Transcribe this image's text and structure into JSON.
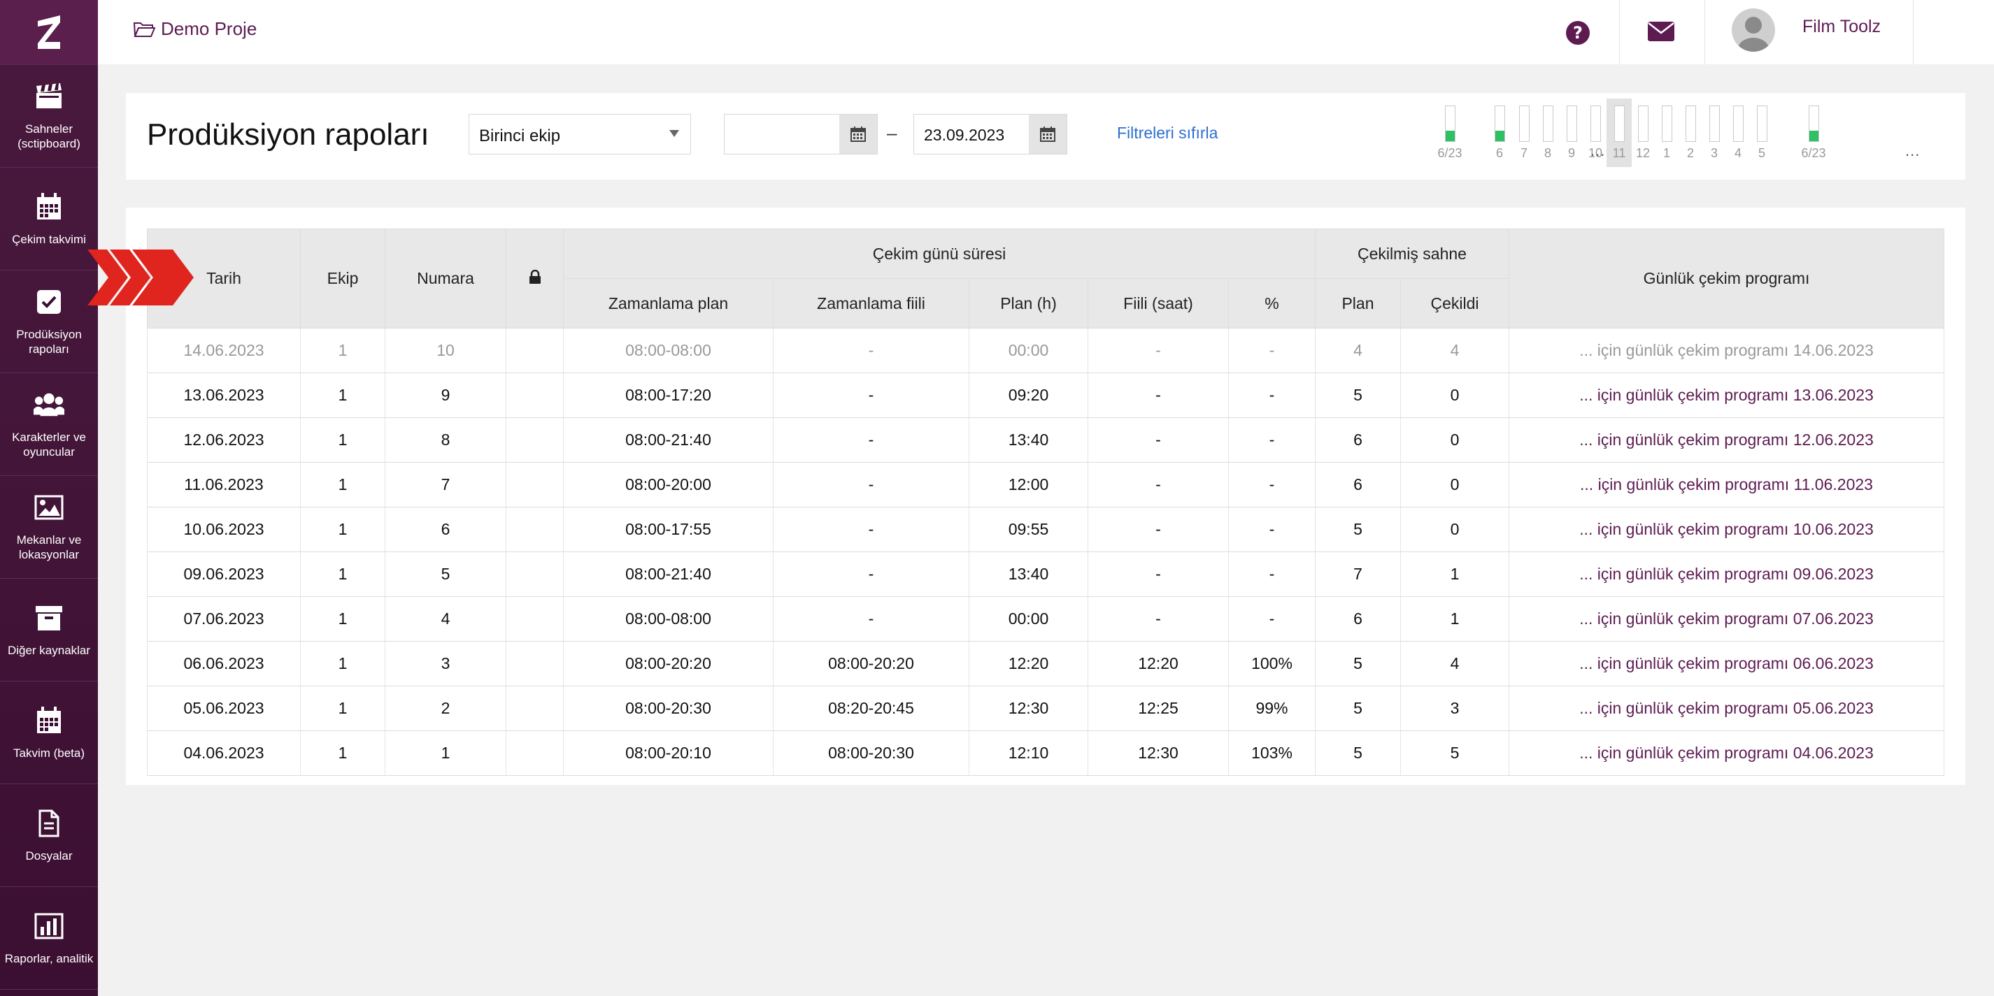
{
  "sidebar": {
    "items": [
      {
        "label": "Sahneler (sctipboard)",
        "icon": "clapperboard-icon"
      },
      {
        "label": "Çekim takvimi",
        "icon": "calendar-icon"
      },
      {
        "label": "Prodüksiyon rapoları",
        "icon": "checkbox-icon"
      },
      {
        "label": "Karakterler ve oyuncular",
        "icon": "people-icon"
      },
      {
        "label": "Mekanlar ve lokasyonlar",
        "icon": "image-icon"
      },
      {
        "label": "Diğer kaynaklar",
        "icon": "archive-icon"
      },
      {
        "label": "Takvim (beta)",
        "icon": "calendar-icon"
      },
      {
        "label": "Dosyalar",
        "icon": "file-icon"
      },
      {
        "label": "Raporlar, analitik",
        "icon": "bar-chart-icon"
      }
    ]
  },
  "topbar": {
    "project": "Demo Proje",
    "user": "Film Toolz",
    "lang": "TR"
  },
  "filters": {
    "title": "Prodüksiyon rapoları",
    "team_select": "Birinci ekip",
    "date_from": "",
    "date_to": "23.09.2023",
    "dash": "–",
    "reset": "Filtreleri sıfırla"
  },
  "timeline": {
    "labels": [
      "6/23",
      "6",
      "7",
      "8",
      "9",
      "10",
      "11",
      "12",
      "1",
      "2",
      "3",
      "4",
      "5",
      "6/23"
    ],
    "fill_fraction": [
      0.3,
      0.3,
      0,
      0,
      0,
      0,
      0,
      0,
      0,
      0,
      0,
      0,
      0,
      0.3
    ],
    "dots": "..."
  },
  "table": {
    "headers": {
      "date": "Tarih",
      "team": "Ekip",
      "number": "Numara",
      "duration_group": "Çekim günü süresi",
      "scenes_group": "Çekilmiş sahne",
      "program": "Günlük çekim programı",
      "sched_plan": "Zamanlama plan",
      "sched_actual": "Zamanlama fiili",
      "plan_h": "Plan (h)",
      "actual_h": "Fiili (saat)",
      "pct": "%",
      "scene_plan": "Plan",
      "scene_shot": "Çekildi"
    },
    "rows": [
      {
        "date": "14.06.2023",
        "team": "1",
        "num": "10",
        "sp": "08:00-08:00",
        "sa": "-",
        "ph": "00:00",
        "ah": "-",
        "pct": "-",
        "plan": "4",
        "shot": "4",
        "link": "... için günlük çekim programı 14.06.2023"
      },
      {
        "date": "13.06.2023",
        "team": "1",
        "num": "9",
        "sp": "08:00-17:20",
        "sa": "-",
        "ph": "09:20",
        "ah": "-",
        "pct": "-",
        "plan": "5",
        "shot": "0",
        "link": "... için günlük çekim programı 13.06.2023"
      },
      {
        "date": "12.06.2023",
        "team": "1",
        "num": "8",
        "sp": "08:00-21:40",
        "sa": "-",
        "ph": "13:40",
        "ah": "-",
        "pct": "-",
        "plan": "6",
        "shot": "0",
        "link": "... için günlük çekim programı 12.06.2023"
      },
      {
        "date": "11.06.2023",
        "team": "1",
        "num": "7",
        "sp": "08:00-20:00",
        "sa": "-",
        "ph": "12:00",
        "ah": "-",
        "pct": "-",
        "plan": "6",
        "shot": "0",
        "link": "... için günlük çekim programı 11.06.2023"
      },
      {
        "date": "10.06.2023",
        "team": "1",
        "num": "6",
        "sp": "08:00-17:55",
        "sa": "-",
        "ph": "09:55",
        "ah": "-",
        "pct": "-",
        "plan": "5",
        "shot": "0",
        "link": "... için günlük çekim programı 10.06.2023"
      },
      {
        "date": "09.06.2023",
        "team": "1",
        "num": "5",
        "sp": "08:00-21:40",
        "sa": "-",
        "ph": "13:40",
        "ah": "-",
        "pct": "-",
        "plan": "7",
        "shot": "1",
        "link": "... için günlük çekim programı 09.06.2023"
      },
      {
        "date": "07.06.2023",
        "team": "1",
        "num": "4",
        "sp": "08:00-08:00",
        "sa": "-",
        "ph": "00:00",
        "ah": "-",
        "pct": "-",
        "plan": "6",
        "shot": "1",
        "link": "... için günlük çekim programı 07.06.2023"
      },
      {
        "date": "06.06.2023",
        "team": "1",
        "num": "3",
        "sp": "08:00-20:20",
        "sa": "08:00-20:20",
        "ph": "12:20",
        "ah": "12:20",
        "pct": "100%",
        "plan": "5",
        "shot": "4",
        "link": "... için günlük çekim programı 06.06.2023"
      },
      {
        "date": "05.06.2023",
        "team": "1",
        "num": "2",
        "sp": "08:00-20:30",
        "sa": "08:20-20:45",
        "ph": "12:30",
        "ah": "12:25",
        "pct": "99%",
        "plan": "5",
        "shot": "3",
        "link": "... için günlük çekim programı 05.06.2023"
      },
      {
        "date": "04.06.2023",
        "team": "1",
        "num": "1",
        "sp": "08:00-20:10",
        "sa": "08:00-20:30",
        "ph": "12:10",
        "ah": "12:30",
        "pct": "103%",
        "plan": "5",
        "shot": "5",
        "link": "... için günlük çekim programı 04.06.2023"
      }
    ]
  },
  "colors": {
    "brand": "#5d1b52",
    "sidebar": "#3b0f32",
    "accent_green": "#2fbf64",
    "link_blue": "#2d6fd1",
    "arrow_red": "#e0241e"
  }
}
